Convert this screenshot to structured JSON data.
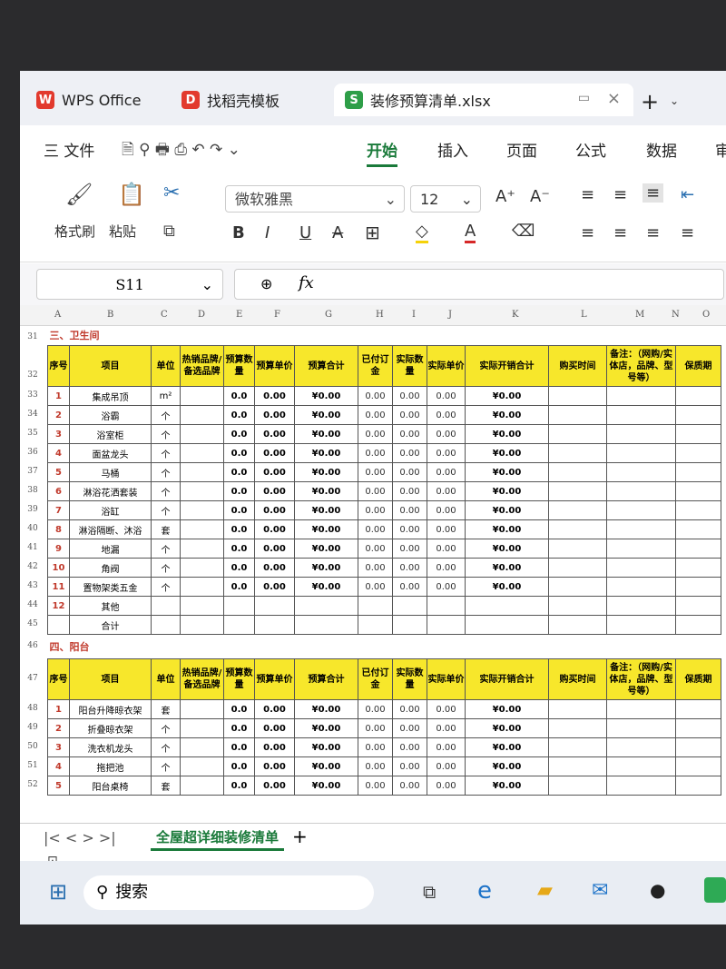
{
  "window": {
    "tabs": [
      {
        "label": "WPS Office",
        "logo": "W"
      },
      {
        "label": "找稻壳模板",
        "logo": "D"
      },
      {
        "label": "装修预算清单.xlsx",
        "logo": "S"
      }
    ],
    "new_tab": "+"
  },
  "menu": {
    "file": "三 文件",
    "items": [
      "开始",
      "插入",
      "页面",
      "公式",
      "数据",
      "审"
    ]
  },
  "ribbon": {
    "format_painter": "格式刷",
    "paste": "粘贴",
    "font_name": "微软雅黑",
    "font_size": "12"
  },
  "formula_bar": {
    "cell_ref": "S11",
    "fx": "fx"
  },
  "columns": [
    "A",
    "B",
    "C",
    "D",
    "E",
    "F",
    "G",
    "H",
    "I",
    "J",
    "K",
    "L",
    "M",
    "N",
    "O"
  ],
  "headers": [
    "序号",
    "项目",
    "单位",
    "热销品牌/备选品牌",
    "预算数量",
    "预算单价",
    "预算合计",
    "已付订金",
    "实际数量",
    "实际单价",
    "实际开销合计",
    "购买时间",
    "备注：（网购/实体店，品牌、型号等）",
    "保质期"
  ],
  "section_bath": {
    "row": "31",
    "title": "三、卫生间",
    "header_row": "32",
    "rows": [
      {
        "r": "33",
        "n": "1",
        "item": "集成吊顶",
        "unit": "m²",
        "qty": "0.0",
        "price": "0.00",
        "total": "¥0.00",
        "dep": "0.00",
        "aq": "0.00",
        "ap": "0.00",
        "at": "¥0.00"
      },
      {
        "r": "34",
        "n": "2",
        "item": "浴霸",
        "unit": "个",
        "qty": "0.0",
        "price": "0.00",
        "total": "¥0.00",
        "dep": "0.00",
        "aq": "0.00",
        "ap": "0.00",
        "at": "¥0.00"
      },
      {
        "r": "35",
        "n": "3",
        "item": "浴室柜",
        "unit": "个",
        "qty": "0.0",
        "price": "0.00",
        "total": "¥0.00",
        "dep": "0.00",
        "aq": "0.00",
        "ap": "0.00",
        "at": "¥0.00"
      },
      {
        "r": "36",
        "n": "4",
        "item": "面盆龙头",
        "unit": "个",
        "qty": "0.0",
        "price": "0.00",
        "total": "¥0.00",
        "dep": "0.00",
        "aq": "0.00",
        "ap": "0.00",
        "at": "¥0.00"
      },
      {
        "r": "37",
        "n": "5",
        "item": "马桶",
        "unit": "个",
        "qty": "0.0",
        "price": "0.00",
        "total": "¥0.00",
        "dep": "0.00",
        "aq": "0.00",
        "ap": "0.00",
        "at": "¥0.00"
      },
      {
        "r": "38",
        "n": "6",
        "item": "淋浴花洒套装",
        "unit": "个",
        "qty": "0.0",
        "price": "0.00",
        "total": "¥0.00",
        "dep": "0.00",
        "aq": "0.00",
        "ap": "0.00",
        "at": "¥0.00"
      },
      {
        "r": "39",
        "n": "7",
        "item": "浴缸",
        "unit": "个",
        "qty": "0.0",
        "price": "0.00",
        "total": "¥0.00",
        "dep": "0.00",
        "aq": "0.00",
        "ap": "0.00",
        "at": "¥0.00"
      },
      {
        "r": "40",
        "n": "8",
        "item": "淋浴隔断、沐浴",
        "unit": "套",
        "qty": "0.0",
        "price": "0.00",
        "total": "¥0.00",
        "dep": "0.00",
        "aq": "0.00",
        "ap": "0.00",
        "at": "¥0.00"
      },
      {
        "r": "41",
        "n": "9",
        "item": "地漏",
        "unit": "个",
        "qty": "0.0",
        "price": "0.00",
        "total": "¥0.00",
        "dep": "0.00",
        "aq": "0.00",
        "ap": "0.00",
        "at": "¥0.00"
      },
      {
        "r": "42",
        "n": "10",
        "item": "角阀",
        "unit": "个",
        "qty": "0.0",
        "price": "0.00",
        "total": "¥0.00",
        "dep": "0.00",
        "aq": "0.00",
        "ap": "0.00",
        "at": "¥0.00"
      },
      {
        "r": "43",
        "n": "11",
        "item": "置物架类五金",
        "unit": "个",
        "qty": "0.0",
        "price": "0.00",
        "total": "¥0.00",
        "dep": "0.00",
        "aq": "0.00",
        "ap": "0.00",
        "at": "¥0.00"
      },
      {
        "r": "44",
        "n": "12",
        "item": "其他",
        "unit": "",
        "qty": "",
        "price": "",
        "total": "",
        "dep": "",
        "aq": "",
        "ap": "",
        "at": ""
      },
      {
        "r": "45",
        "n": "",
        "item": "合计",
        "unit": "",
        "qty": "",
        "price": "",
        "total": "",
        "dep": "",
        "aq": "",
        "ap": "",
        "at": ""
      }
    ]
  },
  "section_balcony": {
    "row": "46",
    "title": "四、阳台",
    "header_row": "47",
    "rows": [
      {
        "r": "48",
        "n": "1",
        "item": "阳台升降晾衣架",
        "unit": "套",
        "qty": "0.0",
        "price": "0.00",
        "total": "¥0.00",
        "dep": "0.00",
        "aq": "0.00",
        "ap": "0.00",
        "at": "¥0.00"
      },
      {
        "r": "49",
        "n": "2",
        "item": "折叠晾衣架",
        "unit": "个",
        "qty": "0.0",
        "price": "0.00",
        "total": "¥0.00",
        "dep": "0.00",
        "aq": "0.00",
        "ap": "0.00",
        "at": "¥0.00"
      },
      {
        "r": "50",
        "n": "3",
        "item": "洗衣机龙头",
        "unit": "个",
        "qty": "0.0",
        "price": "0.00",
        "total": "¥0.00",
        "dep": "0.00",
        "aq": "0.00",
        "ap": "0.00",
        "at": "¥0.00"
      },
      {
        "r": "51",
        "n": "4",
        "item": "拖把池",
        "unit": "个",
        "qty": "0.0",
        "price": "0.00",
        "total": "¥0.00",
        "dep": "0.00",
        "aq": "0.00",
        "ap": "0.00",
        "at": "¥0.00"
      },
      {
        "r": "52",
        "n": "5",
        "item": "阳台桌椅",
        "unit": "套",
        "qty": "0.0",
        "price": "0.00",
        "total": "¥0.00",
        "dep": "0.00",
        "aq": "0.00",
        "ap": "0.00",
        "at": "¥0.00"
      }
    ]
  },
  "sheet_tab": "全屋超详细装修清单",
  "taskbar": {
    "search": "搜索"
  }
}
